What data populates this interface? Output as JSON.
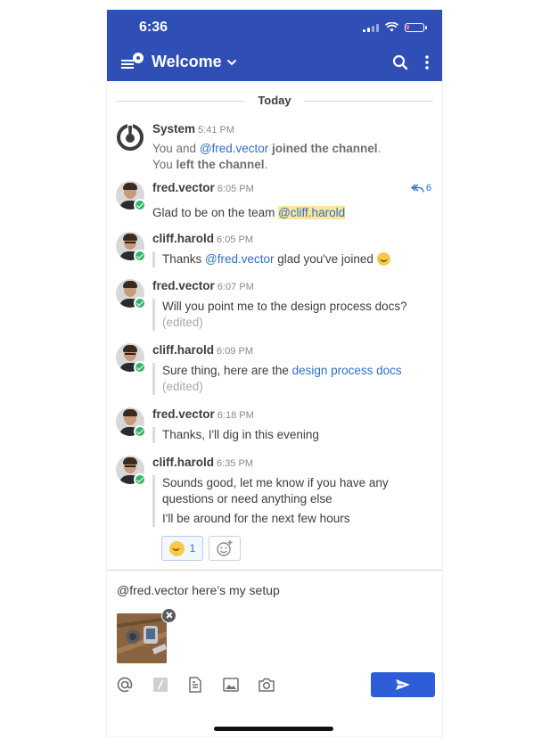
{
  "status_bar": {
    "time": "6:36"
  },
  "header": {
    "title": "Welcome",
    "icons": [
      "menu-icon",
      "search-icon",
      "kebab-icon",
      "chevron-down-icon"
    ]
  },
  "divider": {
    "label": "Today"
  },
  "posts": [
    {
      "user": "System",
      "time": "5:41 PM",
      "line1_pre": "You and ",
      "line1_mention": "@fred.vector",
      "line1_bold": " joined the channel",
      "line1_post": ".",
      "line2_pre": "You ",
      "line2_bold": "left the channel",
      "line2_post": "."
    },
    {
      "user": "fred.vector",
      "time": "6:05 PM",
      "text": "Glad to be on the team ",
      "mention": "@cliff.harold",
      "reply_count": "6"
    },
    {
      "user": "cliff.harold",
      "time": "6:05 PM",
      "text_pre": "Thanks ",
      "mention": "@fred.vector",
      "text_post": " glad you've joined "
    },
    {
      "user": "fred.vector",
      "time": "6:07 PM",
      "text": "Will you point me to the design process docs?",
      "edited": "(edited)"
    },
    {
      "user": "cliff.harold",
      "time": "6:09 PM",
      "text_pre": "Sure thing, here are the ",
      "link": "design process docs",
      "edited": "(edited)"
    },
    {
      "user": "fred.vector",
      "time": "6:18 PM",
      "text": "Thanks, I'll dig in this evening"
    },
    {
      "user": "cliff.harold",
      "time": "6:35 PM",
      "text1": "Sounds good, let me know if you have any",
      "text2": "questions or need anything else",
      "text3": "I'll be around for the next few hours",
      "reaction_count": "1"
    }
  ],
  "composer": {
    "draft": "@fred.vector here’s my setup"
  },
  "colors": {
    "brand": "#2f4fb6",
    "link": "#2f6fc3",
    "send": "#2e5ed7",
    "online": "#34b56e",
    "highlight": "#fbe79b"
  }
}
